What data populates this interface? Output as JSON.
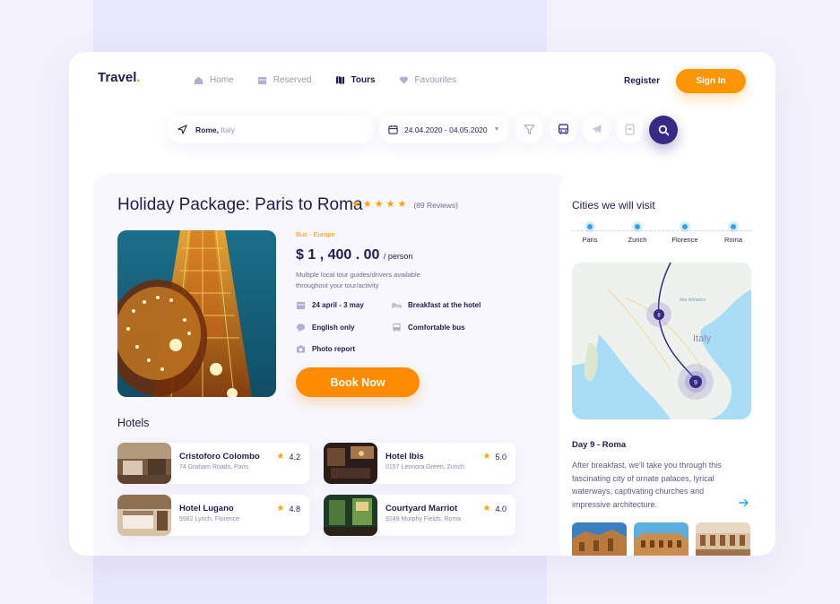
{
  "header": {
    "logo_text": "Travel",
    "logo_dot": ".",
    "nav": [
      {
        "label": "Home",
        "icon": "home-icon",
        "active": false
      },
      {
        "label": "Reserved",
        "icon": "calendar-icon",
        "active": false
      },
      {
        "label": "Tours",
        "icon": "map-icon",
        "active": true
      },
      {
        "label": "Favourites",
        "icon": "heart-icon",
        "active": false
      }
    ],
    "register_label": "Register",
    "signin_label": "Sign In"
  },
  "search": {
    "location_city": "Rome,",
    "location_country": "Italy",
    "date_range": "24.04.2020 - 04.05.2020",
    "icon_buttons": [
      "filter-icon",
      "bus-icon",
      "plane-icon",
      "hotel-icon"
    ],
    "search_icon": "search-icon"
  },
  "tour": {
    "title": "Holiday Package: Paris to Roma",
    "rating_stars": 5,
    "reviews": "(89  Reviews)",
    "tag": "Bus  -  Europe",
    "price": "$ 1 , 400 . 00",
    "price_unit": "/ person",
    "description": "Multiple local tour guides/drivers available throughout your tour/activity",
    "features": [
      {
        "label": "24 april - 3 may",
        "icon": "calendar-icon"
      },
      {
        "label": "Breakfast at the hotel",
        "icon": "bed-icon"
      },
      {
        "label": "English only",
        "icon": "chat-icon"
      },
      {
        "label": "Comfortable bus",
        "icon": "bus-icon"
      },
      {
        "label": "Photo report",
        "icon": "camera-icon"
      }
    ],
    "book_label": "Book Now"
  },
  "hotels": {
    "title": "Hotels",
    "items": [
      {
        "name": "Cristoforo Colombo",
        "address": "74 Graham Roads, Paris",
        "rating": "4.2"
      },
      {
        "name": "Hotel Ibis",
        "address": "0157 Leonora Green, Zurich",
        "rating": "5.0"
      },
      {
        "name": "Hotel Lugano",
        "address": "5982 Lynch, Florence",
        "rating": "4.8"
      },
      {
        "name": "Courtyard Marriot",
        "address": "9249 Murphy Fields, Roma",
        "rating": "4.0"
      }
    ]
  },
  "cities": {
    "title": "Cities we will visit",
    "stops": [
      "Paris",
      "Zurich",
      "Florence",
      "Roma"
    ],
    "map": {
      "country_label": "Italy",
      "sea_label": "Mar Adriatico",
      "markers": [
        "8",
        "9"
      ]
    }
  },
  "day": {
    "title": "Day 9 - Roma",
    "text": "After breakfast, we'll take you through this fascinating city of ornate palaces, lyrical waterways, captivating churches and impressive architecture."
  },
  "colors": {
    "accent": "#ff9500",
    "primary": "#372a84",
    "text": "#231d4f",
    "muted": "#9a97b5",
    "map_water": "#a9dcf5"
  }
}
